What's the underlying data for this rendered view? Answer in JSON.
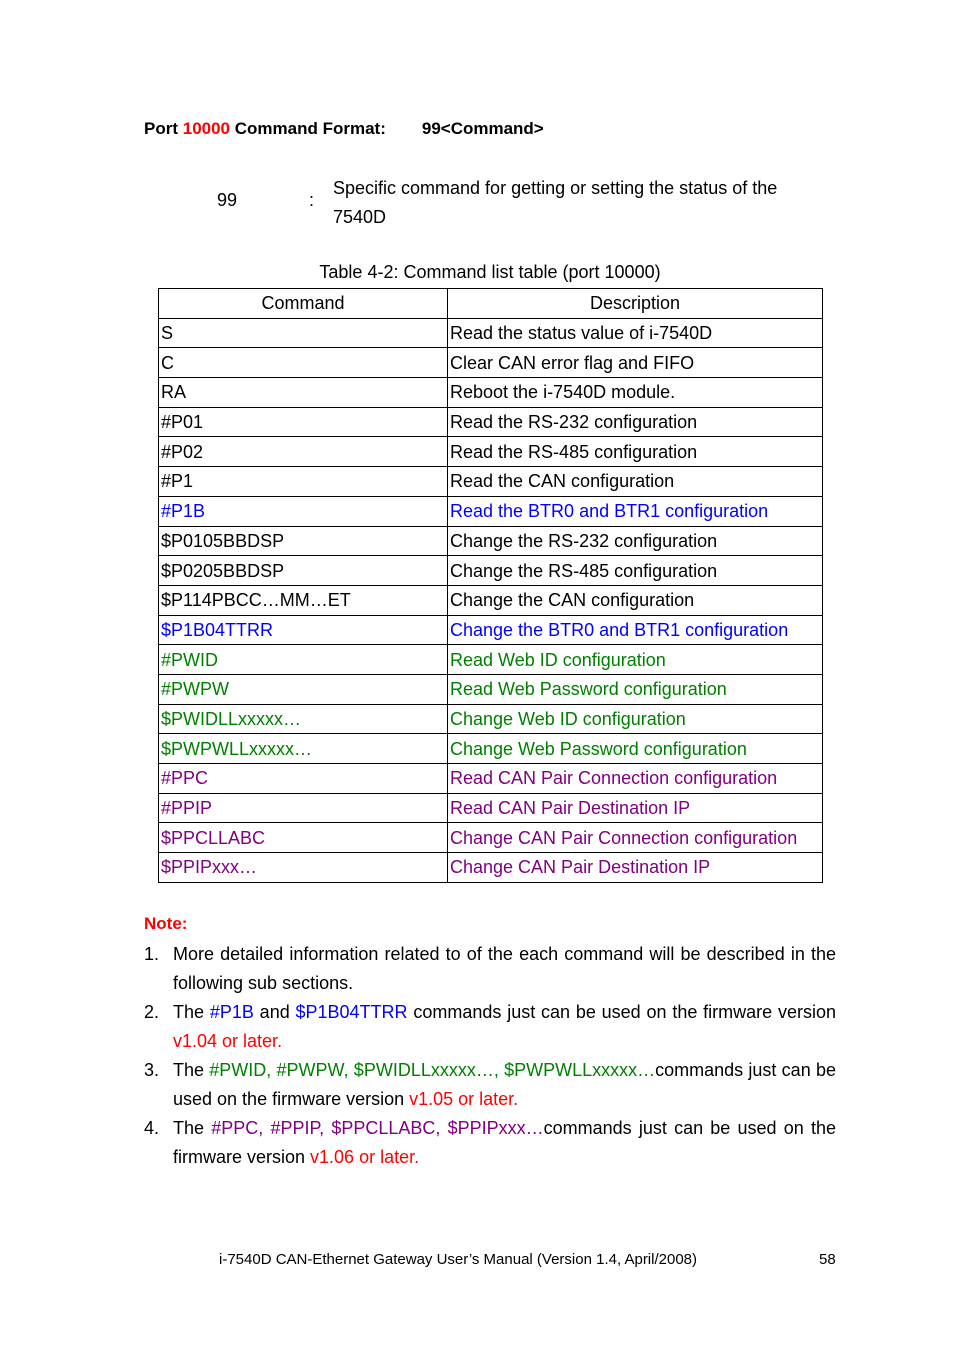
{
  "colors": {
    "red": "#ff0000",
    "blue": "#0000ff",
    "green": "#008000",
    "purple": "#800080",
    "black": "#000000"
  },
  "heading": {
    "prefix": "Port ",
    "port": "10000",
    "suffix": " Command Format:",
    "format": "99<Command>"
  },
  "definition": {
    "term": "99",
    "separator": ":",
    "description": "Specific command for getting or setting the status of the 7540D"
  },
  "table": {
    "caption": "Table 4-2: Command list table (port 10000)",
    "headers": [
      "Command",
      "Description"
    ],
    "rows": [
      {
        "command": "S",
        "description": "Read the status value of i-7540D",
        "color": "black"
      },
      {
        "command": "C",
        "description": "Clear CAN error flag and FIFO",
        "color": "black"
      },
      {
        "command": "RA",
        "description": "Reboot the i-7540D module.",
        "color": "black"
      },
      {
        "command": "#P01",
        "description": "Read the RS-232 configuration",
        "color": "black"
      },
      {
        "command": "#P02",
        "description": "Read the RS-485 configuration",
        "color": "black"
      },
      {
        "command": "#P1",
        "description": "Read the CAN configuration",
        "color": "black"
      },
      {
        "command": "#P1B",
        "description": "Read the BTR0 and BTR1 configuration",
        "color": "blue"
      },
      {
        "command": "$P0105BBDSP",
        "description": "Change the RS-232 configuration",
        "color": "black"
      },
      {
        "command": "$P0205BBDSP",
        "description": "Change the RS-485 configuration",
        "color": "black"
      },
      {
        "command": "$P114PBCC…MM…ET",
        "description": "Change the CAN configuration",
        "color": "black"
      },
      {
        "command": "$P1B04TTRR",
        "description": "Change the BTR0 and BTR1 configuration",
        "color": "blue"
      },
      {
        "command": "#PWID",
        "description": "Read Web ID configuration",
        "color": "green"
      },
      {
        "command": "#PWPW",
        "description": "Read Web Password configuration",
        "color": "green"
      },
      {
        "command": "$PWIDLLxxxxx…",
        "description": "Change Web ID configuration",
        "color": "green"
      },
      {
        "command": "$PWPWLLxxxxx…",
        "description": "Change Web Password configuration",
        "color": "green"
      },
      {
        "command": "#PPC",
        "description": "Read CAN Pair Connection configuration",
        "color": "purple"
      },
      {
        "command": "#PPIP",
        "description": "Read CAN Pair Destination IP",
        "color": "purple"
      },
      {
        "command": "$PPCLLABC",
        "description": "Change CAN Pair Connection configuration",
        "color": "purple"
      },
      {
        "command": "$PPIPxxx…",
        "description": "Change CAN Pair Destination IP",
        "color": "purple"
      }
    ]
  },
  "notes": {
    "title": "Note:",
    "items": [
      {
        "number": "1.",
        "segments": [
          {
            "text": "More detailed information related to of the each command will be described in the following sub sections.",
            "color": "black"
          }
        ]
      },
      {
        "number": "2.",
        "segments": [
          {
            "text": "The ",
            "color": "black"
          },
          {
            "text": "#P1B",
            "color": "blue"
          },
          {
            "text": " and ",
            "color": "black"
          },
          {
            "text": "$P1B04TTRR",
            "color": "blue"
          },
          {
            "text": " commands just can be used on the firmware version ",
            "color": "black"
          },
          {
            "text": "v1.04 or later.",
            "color": "red"
          }
        ]
      },
      {
        "number": "3.",
        "segments": [
          {
            "text": "The ",
            "color": "black"
          },
          {
            "text": "#PWID, #PWPW, $PWIDLLxxxxx…, $PWPWLLxxxxx…",
            "color": "green"
          },
          {
            "text": "commands just can be used on the firmware version ",
            "color": "black"
          },
          {
            "text": "v1.05 or later.",
            "color": "red"
          }
        ]
      },
      {
        "number": "4.",
        "segments": [
          {
            "text": "The ",
            "color": "black"
          },
          {
            "text": "#PPC, #PPIP, $PPCLLABC, $PPIPxxx…",
            "color": "purple"
          },
          {
            "text": "commands just can be used on the firmware version ",
            "color": "black"
          },
          {
            "text": "v1.06 or later.",
            "color": "red"
          }
        ]
      }
    ]
  },
  "footer": {
    "text": "i-7540D CAN-Ethernet Gateway User’s Manual (Version 1.4, April/2008)",
    "page_number": "58"
  }
}
